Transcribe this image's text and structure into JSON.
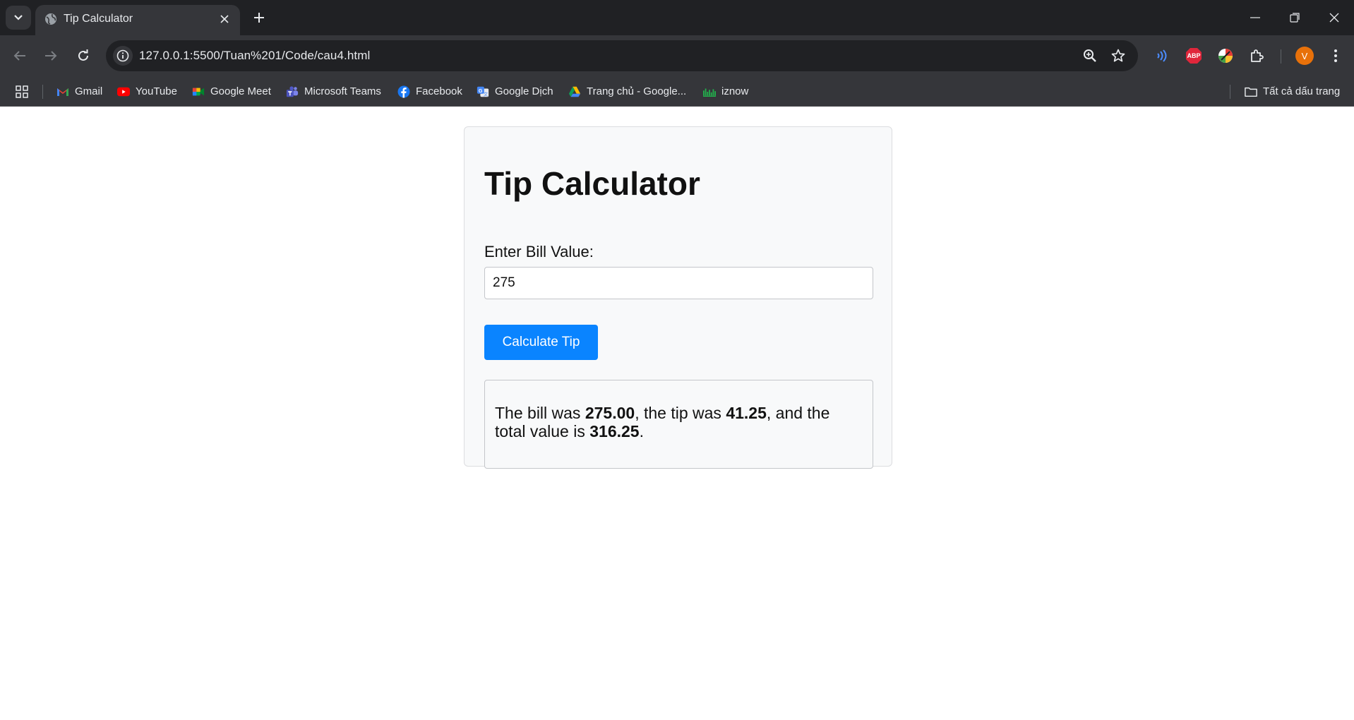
{
  "browser": {
    "tab_title": "Tip Calculator",
    "url": "127.0.0.1:5500/Tuan%201/Code/cau4.html",
    "profile_initial": "V",
    "extension_badge": "ABP",
    "bookmarks": [
      {
        "label": "Gmail",
        "icon": "gmail-icon"
      },
      {
        "label": "YouTube",
        "icon": "youtube-icon"
      },
      {
        "label": "Google Meet",
        "icon": "google-meet-icon"
      },
      {
        "label": "Microsoft Teams",
        "icon": "teams-icon"
      },
      {
        "label": "Facebook",
        "icon": "facebook-icon"
      },
      {
        "label": "Google Dịch",
        "icon": "google-translate-icon"
      },
      {
        "label": "Trang chủ - Google...",
        "icon": "google-drive-icon"
      },
      {
        "label": "iznow",
        "icon": "iznow-icon"
      }
    ],
    "all_bookmarks_label": "Tất cả dấu trang"
  },
  "app": {
    "title": "Tip Calculator",
    "bill_label": "Enter Bill Value:",
    "bill_value": "275",
    "calculate_label": "Calculate Tip",
    "result": {
      "prefix": "The bill was ",
      "bill": "275.00",
      "mid1": ", the tip was ",
      "tip": "41.25",
      "mid2": ", and the total value is ",
      "total": "316.25",
      "suffix": "."
    }
  },
  "colors": {
    "accent_button": "#0a84ff",
    "chrome_dark": "#202124",
    "chrome_toolbar": "#35363a",
    "card_bg": "#f8f9fa"
  }
}
